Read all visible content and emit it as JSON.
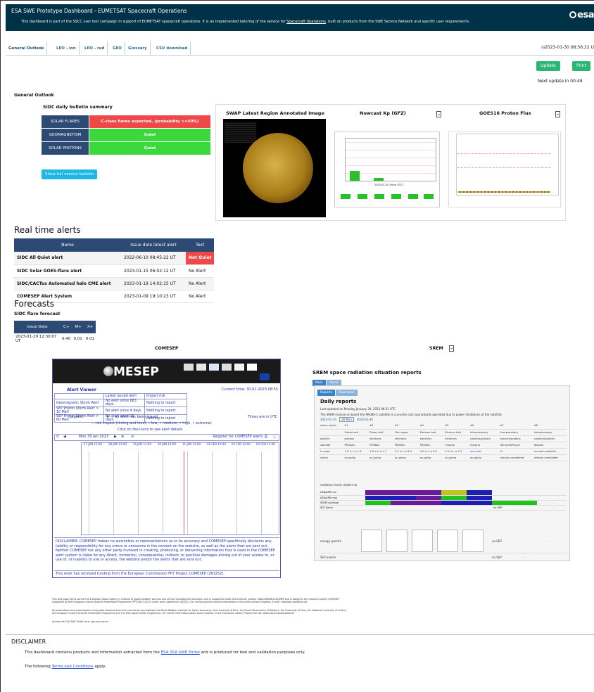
{
  "header": {
    "title": "ESA SWE Prototype Dashboard - EUMETSAT Spacecraft Operations",
    "subtitle_prefix": "This dashboard is part of the SSCC user test campaign in support of EUMETSAT spacecraft operations. It is an implemented tailoring of the service for",
    "subtitle_link": "Spacecraft Operations",
    "subtitle_suffix": ", built on products from the SWE Service Network and specific user requirements.",
    "logo": "esa"
  },
  "tabs": [
    "General Outlook",
    "LEO - ion",
    "LEO - rad",
    "GEO",
    "Glossary",
    "CSV download"
  ],
  "clock": "2023-01-30 08:56:22 U",
  "toolbar": {
    "update": "Update",
    "print": "Print",
    "next_update": "Next update in 00:49"
  },
  "general": {
    "heading": "General Outlook",
    "bulletin_title": "SIDC daily bulletin summary",
    "bulletin_rows": [
      {
        "label": "SOLAR FLARES",
        "value": "C-class flares expected, (probability >=50%)",
        "status": "red"
      },
      {
        "label": "GEOMAGNETISM",
        "value": "Quiet",
        "status": "green"
      },
      {
        "label": "SOLAR PROTONS",
        "value": "Quiet",
        "status": "green"
      }
    ],
    "full_bulletin_button": "Show full version bulletin"
  },
  "panels": {
    "swap_title": "SWAP Latest Region Annotated Image",
    "kp_title": "Nowcast Kp (GFZ)",
    "goes_title": "GOES16 Proton Flux"
  },
  "kp_chart": {
    "ylabel": "Kp index",
    "xlabel": "2023-01-30 (Hour UTC)",
    "x_ticks": [
      "0",
      "3",
      "6",
      "9",
      "12",
      "15",
      "18",
      "21",
      "24"
    ],
    "mini_dates": [
      "2023-01-24",
      "2023-01-25",
      "2023-01-26",
      "2023-01-27",
      "2023-01-28",
      "2023-01-29"
    ]
  },
  "alerts": {
    "heading": "Real time alerts",
    "columns": [
      "Name",
      "Issue date latest alert",
      "Text"
    ],
    "rows": [
      {
        "name": "SIDC All Quiet alert",
        "date": "2022-06-10 08:45:22 UT",
        "text": "Not Quiet",
        "flag": "red"
      },
      {
        "name": "SIDC Solar GOES-flare alert",
        "date": "2023-01-15 06:02:12 UT",
        "text": "No Alert",
        "flag": "none"
      },
      {
        "name": "SIDC/CACTus Automated halo CME alert",
        "date": "2023-01-19 14:02:15 UT",
        "text": "No Alert",
        "flag": "none"
      },
      {
        "name": "COMESEP Alert System",
        "date": "2023-01-09 19:10:23 UT",
        "text": "No Alert",
        "flag": "none"
      }
    ]
  },
  "forecasts": {
    "heading": "Forecasts",
    "sub": "SIDC flare forecast",
    "columns": [
      "Issue Date",
      "C+",
      "M+",
      "X+"
    ],
    "row": [
      "2023-01-29 12:30:07 UT",
      "0.40",
      "0.01",
      "0.01"
    ]
  },
  "comesep": {
    "title": "COMESEP",
    "logo_text": "MESEP",
    "alert_viewer": "Alert Viewer",
    "current_time": "Current time: 30-01-2023 08:55",
    "grid_headers": [
      "",
      "Latest issued alert",
      "Impact risk"
    ],
    "grid_rows": [
      [
        "Geomagnetic Storm Alert",
        "No alert since 883 days",
        "Nothing to report"
      ],
      [
        "SEP Proton Storm Alert > 10 MeV",
        "No alert since 4 days",
        "Nothing to report"
      ],
      [
        "SEP Proton Storm Alert > 60 MeV",
        "No alert since 15 days",
        "Nothing to report"
      ]
    ],
    "legend": "Legend:",
    "legend_star": "... an alert has been issued",
    "legend_risk": "... risk impact (timing and level, • low, • medium, • high, • extreme)",
    "legend_click": "Click on the icons to see alert details",
    "times_utc": "Times are in UTC",
    "nav_date": "Mon 30 Jan 2023",
    "register": "Register for COMESEP alerts",
    "chart_dates": [
      "27 JAN 12:00",
      "28 JAN 12:00",
      "29 JAN 12:00",
      "30 JAN 12:00",
      "31 JAN 12:00",
      "01 FEB 12:00",
      "02 FEB 12:00",
      "03 FEB 12:00"
    ],
    "disclaimer": "DISCLAIMER: COMESEP makes no warranties or representations as to its accuracy and COMESEP specifically disclaims any liability or responsibility for any errors or omissions in the content on the website, as well as the alerts that are sent out. Neither COMESEP nor any other party involved in creating, producing, or delivering information that is used in the COMESEP alert system is liable for any direct, incidental, consequential, indirect, or punitive damages arising out of your access to, or use of, or inability to use or access, the website and/or the alerts that are sent out.",
    "funding": "This work has received funding from the European Commission FP7 Project COMESEP (263252)."
  },
  "srem": {
    "title": "SREM",
    "report_title": "SREM space radiation situation reports",
    "tabs": [
      "Main",
      "About"
    ],
    "subtabs": [
      "Reports",
      "Download"
    ],
    "daily": "Daily reports",
    "updated": "Last updated on Monday January 30, 2023 08:31 UTC",
    "note": "The SREM module on board the PROBA-1 satellite is currently only sporadically operated due to power limitations of the satellite.",
    "dates": [
      "2023-01-31",
      "30 Mon",
      "2023-01-30"
    ],
    "cols": [
      "space region",
      "#1",
      "#2",
      "#3",
      "#4",
      "#5",
      "#6",
      "#7",
      "#8"
    ],
    "rows": [
      [
        "",
        "Proton belt",
        "Proton belt",
        "Slot region",
        "Electron belt",
        "Electron belt",
        "Interplanetary",
        "Interplanetary",
        "Interplanetary"
      ],
      [
        "particle",
        "protons",
        "electrons",
        "electrons",
        "electrons",
        "electrons",
        "cosmics/protons",
        "cosmics/protons",
        "cosmics/protons"
      ],
      [
        "satellite",
        "PROBA1",
        "PROBA1",
        "PROBA1",
        "PROBA1",
        "Integral",
        "Integral",
        "Herschel/Planck",
        "Rosetta"
      ],
      [
        "L-range",
        "1.2 ≤ L ≤ 1.5",
        "1.6 ≤ L ≤ 1.7",
        "2.5 ≤ L ≤ 3.0",
        "4.0 ≤ L ≤ 5.0",
        "5.0 ≤ L ≤ 7.0",
        "see orbit",
        "L2",
        "no orbit available"
      ],
      [
        "status",
        "on-going",
        "on-going",
        "on-going",
        "on-going",
        "on-going",
        "on-going",
        "mission completed",
        "mission completed"
      ]
    ],
    "rl_title": "radiation levels relative to",
    "rl_rows": [
      "AE8/AP8 min",
      "AE8/AP8 max",
      "SREM average",
      "SEP alarm"
    ],
    "no_sep": "no SEP",
    "energy": "energy spectra",
    "sep_events": "SEP events",
    "dash": "-"
  },
  "footer": {
    "line1": "This web page forms part of the European Space Agency's network of space weather services and service development activities, and is supported under ESA contract number 4000136996/21/D/MRP and is based on the research project COMESEP supported by the European Union's Seventh Framework Programme (FP7/2007-2013) under grant agreement 263252. For further product-related information or enquiries contact helpdesk. E-mail: helpdesk.swe@esa.int",
    "line2": "All publications and presentations using data obtained from this site should acknowledge the Royal Belgian Institute for Space Aeronomy, the University of Bern, the Royal Observatory of Belgium, the University of Graz, the National University of Ireland, the European Union's Seventh Framework Programme and The ESA Space Safety Programme. For further information about space weather in the ESA Space Safety Programme see: www.esa.int/spaceweather",
    "line3": "Access the ESA SWE Portal here: swe.ssa.esa.int"
  },
  "disclaimer": {
    "heading": "DISCLAIMER",
    "p1_prefix": "This dashboard contains products and information extracted from the",
    "p1_link": "ESA SSA SWE Portal",
    "p1_suffix": "and is produced for test and validation purposes only.",
    "p2_prefix": "The following",
    "p2_link": "Terms and Conditions",
    "p2_suffix": "apply."
  },
  "colors": {
    "header_bg": "#003247",
    "table_head": "#2c4a73",
    "red": "#f04848",
    "green": "#3ad83a",
    "button_green": "#2bb673",
    "button_blue": "#1fb6e8"
  }
}
